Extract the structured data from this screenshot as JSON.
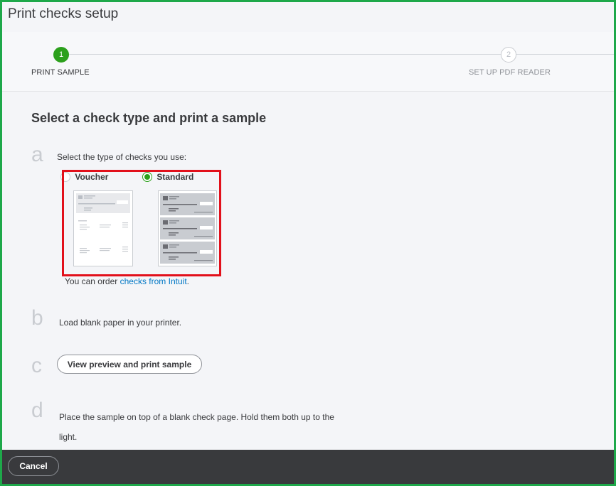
{
  "window": {
    "title": "Print checks setup"
  },
  "stepper": {
    "steps": [
      {
        "number": "1",
        "label": "PRINT SAMPLE",
        "active": true
      },
      {
        "number": "2",
        "label": "SET UP PDF READER",
        "active": false
      }
    ],
    "active_color": "#2ca01c"
  },
  "main": {
    "heading": "Select a check type and print a sample",
    "step_a": {
      "letter": "a",
      "instruction": "Select the type of checks you use:",
      "options": [
        {
          "label": "Voucher",
          "selected": false
        },
        {
          "label": "Standard",
          "selected": true
        }
      ],
      "order_prefix": "You can order ",
      "order_link": "checks from Intuit",
      "order_suffix": "."
    },
    "step_b": {
      "letter": "b",
      "instruction": "Load blank paper in your printer."
    },
    "step_c": {
      "letter": "c",
      "button_label": "View preview and print sample"
    },
    "step_d": {
      "letter": "d",
      "instruction": "Place the sample on top of a blank check page. Hold them both up to the light."
    }
  },
  "footer": {
    "cancel_label": "Cancel"
  },
  "colors": {
    "frame_border": "#1ea84a",
    "highlight_border": "#e2101b",
    "link": "#0077c5",
    "footer_bg": "#393a3d"
  }
}
